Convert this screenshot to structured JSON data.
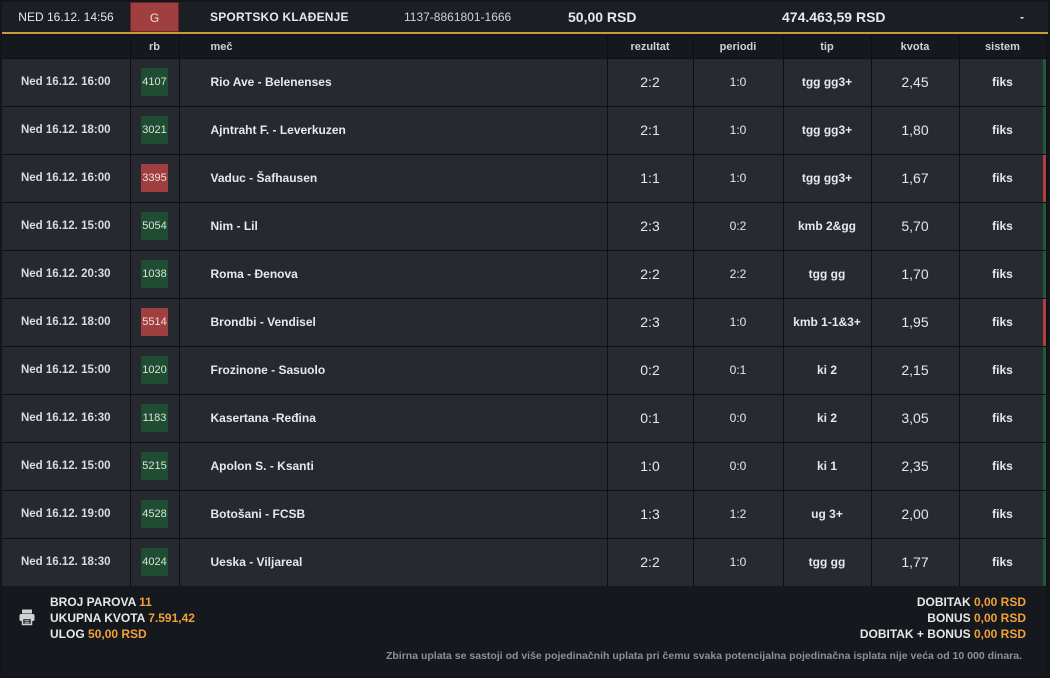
{
  "header": {
    "datetime": "NED 16.12. 14:56",
    "badge": "G",
    "title": "SPORTSKO KLAĐENJE",
    "ticket_code": "1137-8861801-1666",
    "stake": "50,00 RSD",
    "balance": "474.463,59 RSD",
    "dash": "-"
  },
  "columns": {
    "rb": "rb",
    "match": "meč",
    "result": "rezultat",
    "periods": "periodi",
    "tip": "tip",
    "odds": "kvota",
    "system": "sistem"
  },
  "rows": [
    {
      "date": "Ned 16.12. 16:00",
      "rb": "4107",
      "rb_status": "green",
      "match": "Rio Ave - Belenenses",
      "result": "2:2",
      "periods": "1:0",
      "tip": "tgg gg3+",
      "odds": "2,45",
      "system": "fiks",
      "flag": "green"
    },
    {
      "date": "Ned 16.12. 18:00",
      "rb": "3021",
      "rb_status": "green",
      "match": "Ajntraht F. - Leverkuzen",
      "result": "2:1",
      "periods": "1:0",
      "tip": "tgg gg3+",
      "odds": "1,80",
      "system": "fiks",
      "flag": "green"
    },
    {
      "date": "Ned 16.12. 16:00",
      "rb": "3395",
      "rb_status": "red",
      "match": "Vaduc - Šafhausen",
      "result": "1:1",
      "periods": "1:0",
      "tip": "tgg gg3+",
      "odds": "1,67",
      "system": "fiks",
      "flag": "red"
    },
    {
      "date": "Ned 16.12. 15:00",
      "rb": "5054",
      "rb_status": "green",
      "match": "Nim - Lil",
      "result": "2:3",
      "periods": "0:2",
      "tip": "kmb 2&gg",
      "odds": "5,70",
      "system": "fiks",
      "flag": "green"
    },
    {
      "date": "Ned 16.12. 20:30",
      "rb": "1038",
      "rb_status": "green",
      "match": "Roma - Đenova",
      "result": "2:2",
      "periods": "2:2",
      "tip": "tgg gg",
      "odds": "1,70",
      "system": "fiks",
      "flag": "green"
    },
    {
      "date": "Ned 16.12. 18:00",
      "rb": "5514",
      "rb_status": "red",
      "match": "Brondbi - Vendisel",
      "result": "2:3",
      "periods": "1:0",
      "tip": "kmb 1-1&3+",
      "odds": "1,95",
      "system": "fiks",
      "flag": "red"
    },
    {
      "date": "Ned 16.12. 15:00",
      "rb": "1020",
      "rb_status": "green",
      "match": "Frozinone - Sasuolo",
      "result": "0:2",
      "periods": "0:1",
      "tip": "ki 2",
      "odds": "2,15",
      "system": "fiks",
      "flag": "green"
    },
    {
      "date": "Ned 16.12. 16:30",
      "rb": "1183",
      "rb_status": "green",
      "match": "Kasertana -Ređina",
      "result": "0:1",
      "periods": "0:0",
      "tip": "ki 2",
      "odds": "3,05",
      "system": "fiks",
      "flag": "green"
    },
    {
      "date": "Ned 16.12. 15:00",
      "rb": "5215",
      "rb_status": "green",
      "match": "Apolon S. - Ksanti",
      "result": "1:0",
      "periods": "0:0",
      "tip": "ki 1",
      "odds": "2,35",
      "system": "fiks",
      "flag": "green"
    },
    {
      "date": "Ned 16.12. 19:00",
      "rb": "4528",
      "rb_status": "green",
      "match": "Botošani - FCSB",
      "result": "1:3",
      "periods": "1:2",
      "tip": "ug 3+",
      "odds": "2,00",
      "system": "fiks",
      "flag": "green"
    },
    {
      "date": "Ned 16.12. 18:30",
      "rb": "4024",
      "rb_status": "green",
      "match": "Ueska - Viljareal",
      "result": "2:2",
      "periods": "1:0",
      "tip": "tgg gg",
      "odds": "1,77",
      "system": "fiks",
      "flag": "green"
    }
  ],
  "footer": {
    "pairs_label": "BROJ PAROVA",
    "pairs_value": "11",
    "total_odds_label": "UKUPNA KVOTA",
    "total_odds_value": "7.591,42",
    "stake_label": "ULOG",
    "stake_value": "50,00 RSD",
    "win_label": "DOBITAK",
    "win_value": "0,00 RSD",
    "bonus_label": "BONUS",
    "bonus_value": "0,00 RSD",
    "win_bonus_label": "DOBITAK + BONUS",
    "win_bonus_value": "0,00 RSD",
    "note": "Zbirna uplata se sastoji od više pojedinačnih uplata pri čemu svaka potencijalna pojedinačna isplata nije veća od 10 000 dinara."
  },
  "colors": {
    "accent": "#c99a3b",
    "win_green": "#1f4d33",
    "loss_red": "#a03f3f",
    "highlight": "#f0a13a"
  },
  "icons": {
    "print": "print-icon"
  }
}
